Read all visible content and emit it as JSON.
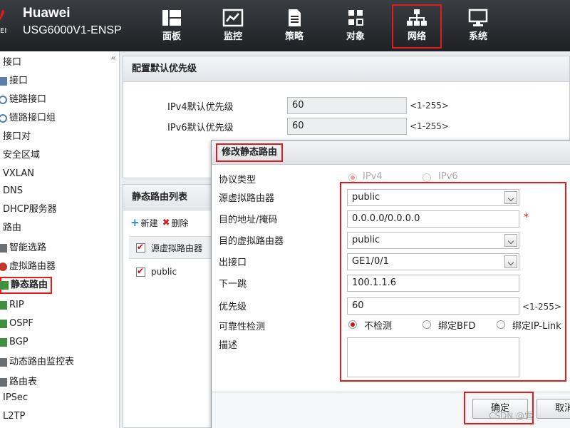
{
  "header": {
    "brand": "Huawei",
    "model": "USG6000V1-ENSP",
    "brand_edge": "EI",
    "nav": [
      {
        "label": "面板",
        "icon": "dashboard-icon"
      },
      {
        "label": "监控",
        "icon": "monitor-chart-icon"
      },
      {
        "label": "策略",
        "icon": "policy-document-icon"
      },
      {
        "label": "对象",
        "icon": "object-icon"
      },
      {
        "label": "网络",
        "icon": "network-topology-icon"
      },
      {
        "label": "系统",
        "icon": "system-computer-icon"
      }
    ],
    "active_nav": "网络"
  },
  "sidebar": {
    "collapse": "«",
    "items": [
      {
        "label": "接口",
        "icon": ""
      },
      {
        "label": "接口",
        "icon": "interface-icon"
      },
      {
        "label": "链路接口",
        "icon": "link-interface-icon"
      },
      {
        "label": "链路接口组",
        "icon": "link-group-icon"
      },
      {
        "label": "接口对",
        "icon": ""
      },
      {
        "label": "安全区域",
        "icon": ""
      },
      {
        "label": "VXLAN",
        "icon": ""
      },
      {
        "label": "DNS",
        "icon": ""
      },
      {
        "label": "DHCP服务器",
        "icon": ""
      },
      {
        "label": "路由",
        "icon": ""
      },
      {
        "label": "智能选路",
        "icon": "smart-route-icon"
      },
      {
        "label": "虚拟路由器",
        "icon": "virtual-router-icon"
      },
      {
        "label": "静态路由",
        "icon": "static-route-icon"
      },
      {
        "label": "RIP",
        "icon": "rip-icon"
      },
      {
        "label": "OSPF",
        "icon": "ospf-icon"
      },
      {
        "label": "BGP",
        "icon": "bgp-icon"
      },
      {
        "label": "动态路由监控表",
        "icon": "dynamic-route-icon"
      },
      {
        "label": "路由表",
        "icon": "route-table-icon"
      },
      {
        "label": "IPSec",
        "icon": ""
      },
      {
        "label": "L2TP",
        "icon": ""
      }
    ],
    "active_item": "静态路由"
  },
  "priority_panel": {
    "title": "配置默认优先级",
    "ipv4_label": "IPv4默认优先级",
    "ipv4_value": "60",
    "ipv6_label": "IPv6默认优先级",
    "ipv6_value": "60",
    "range_hint": "<1-255>"
  },
  "routes_panel": {
    "title": "静态路由列表",
    "new_label": "新建",
    "delete_label": "删除",
    "column_header": "源虚拟路由器",
    "rows": [
      "public"
    ]
  },
  "dialog": {
    "title": "修改静态路由",
    "protocol_label": "协议类型",
    "protocol_options": [
      "IPv4",
      "IPv6"
    ],
    "protocol_selected": "IPv4",
    "source_vr_label": "源虚拟路由器",
    "source_vr_value": "public",
    "dest_label": "目的地址/掩码",
    "dest_value": "0.0.0.0/0.0.0.0",
    "dest_vr_label": "目的虚拟路由器",
    "dest_vr_value": "public",
    "out_if_label": "出接口",
    "out_if_value": "GE1/0/1",
    "next_hop_label": "下一跳",
    "next_hop_value": "100.1.1.6",
    "priority_label": "优先级",
    "priority_value": "60",
    "priority_hint": "<1-255>",
    "reliability_label": "可靠性检测",
    "reliability_options": [
      "不检测",
      "绑定BFD",
      "绑定IP-Link"
    ],
    "reliability_selected": "不检测",
    "desc_label": "描述",
    "required_mark": "*",
    "ok_label": "确定",
    "cancel_label": "取消"
  },
  "watermark": "CSDN @雪"
}
